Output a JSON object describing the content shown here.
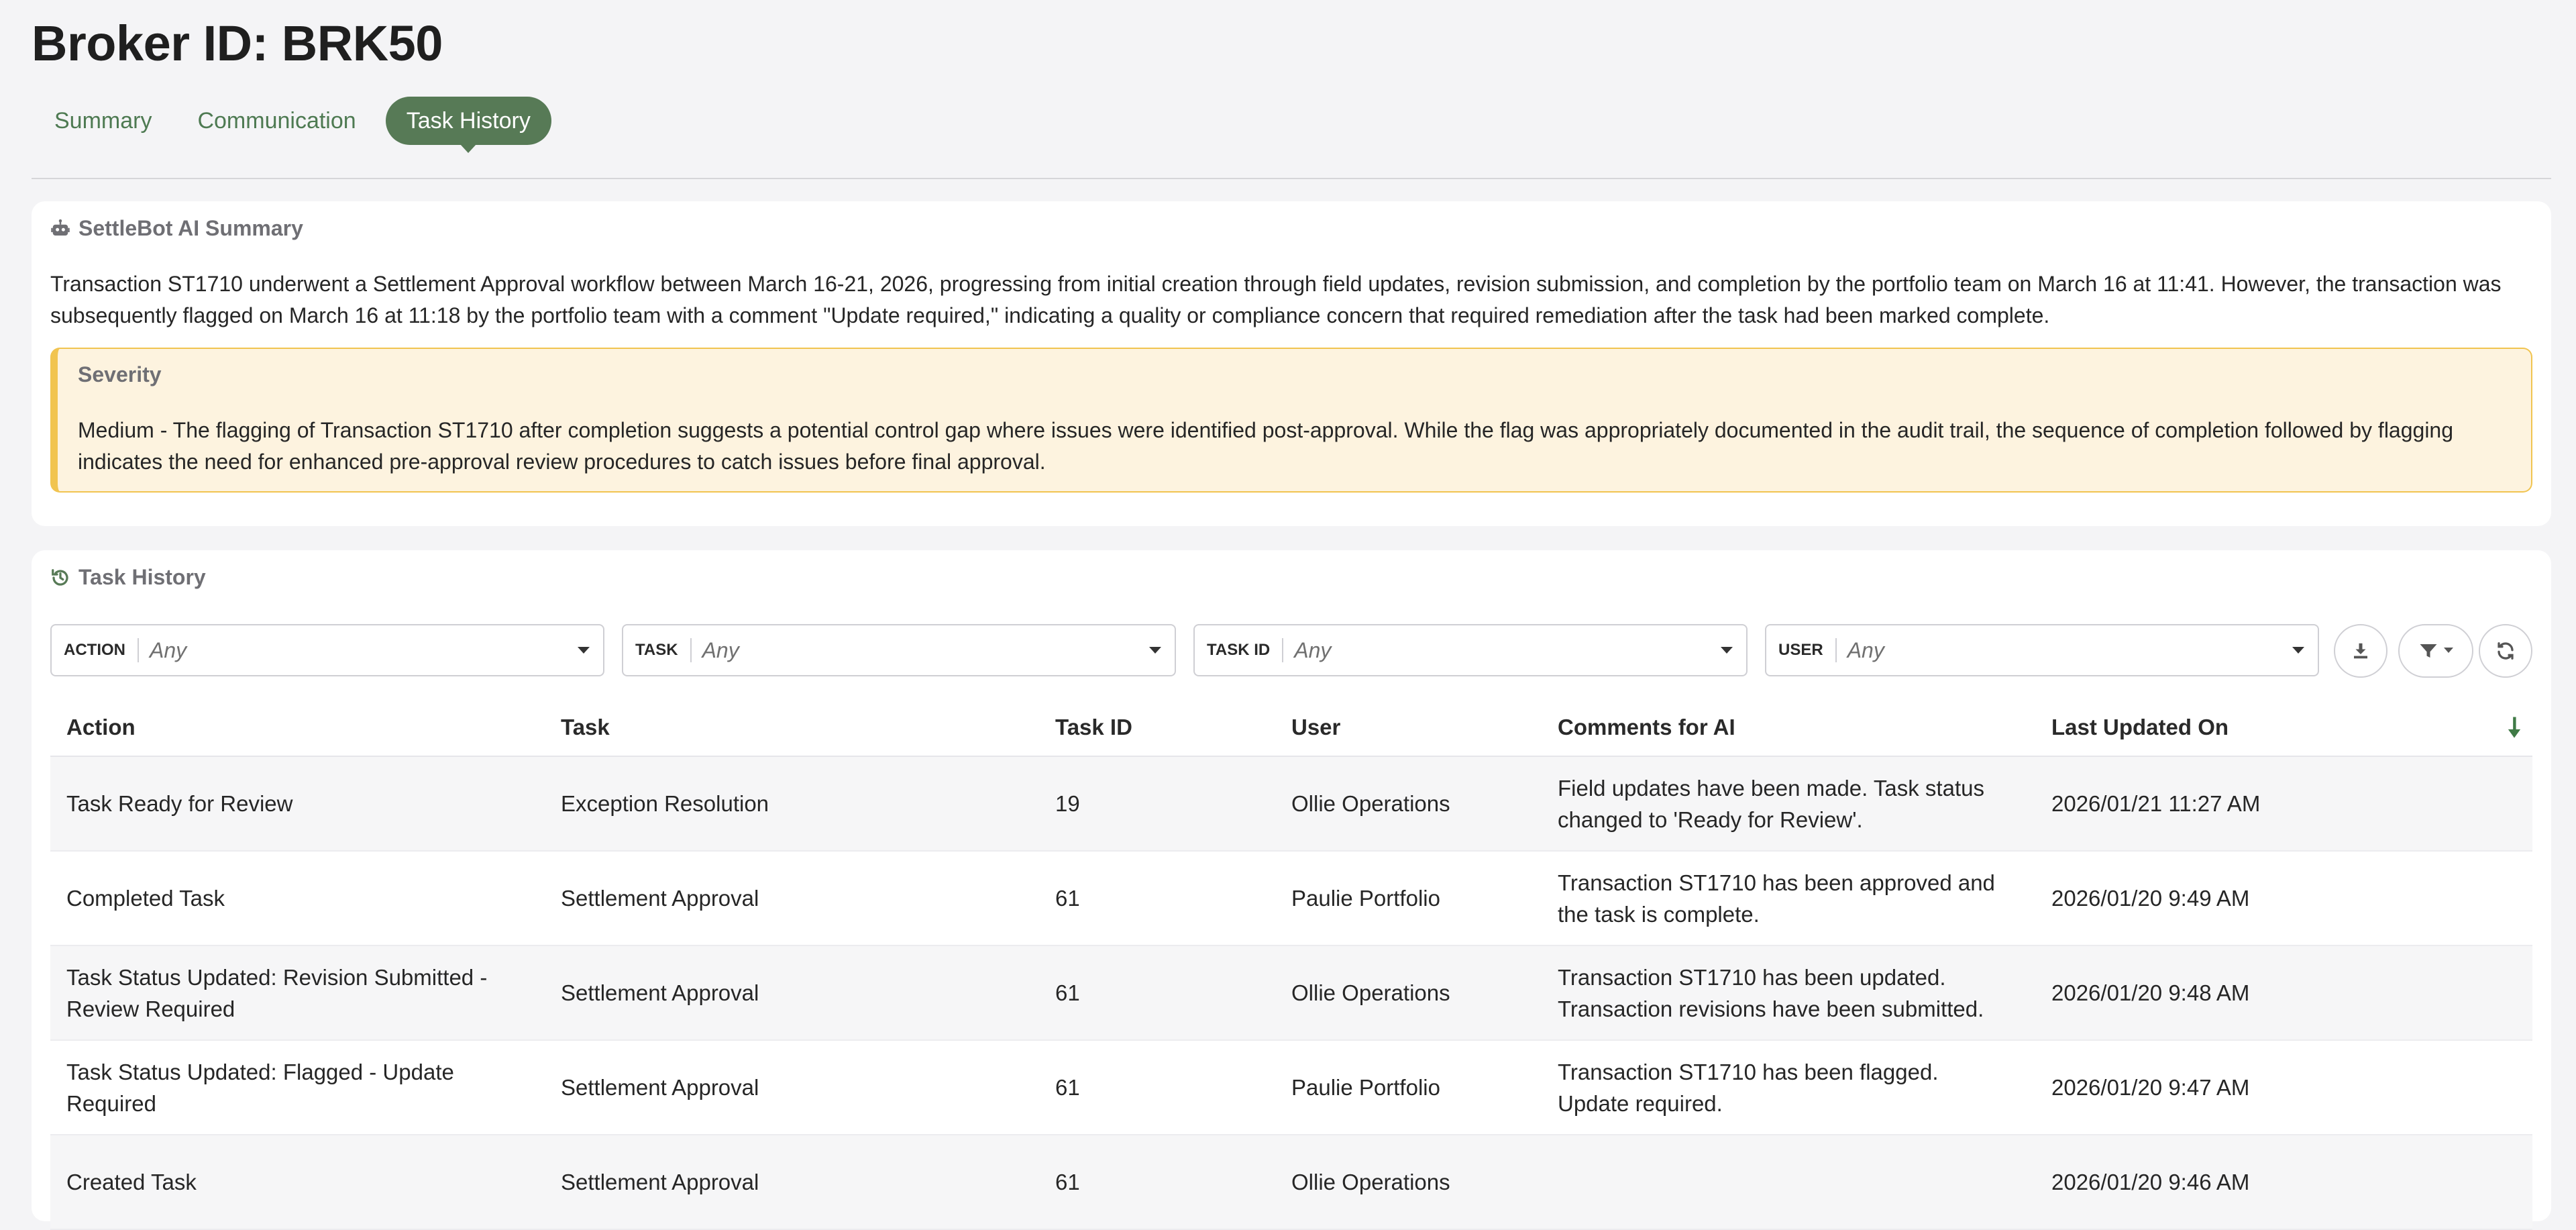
{
  "header": {
    "title": "Broker ID: BRK50",
    "tabs": [
      {
        "label": "Summary",
        "active": false
      },
      {
        "label": "Communication",
        "active": false
      },
      {
        "label": "Task History",
        "active": true
      }
    ]
  },
  "summary": {
    "title": "SettleBot AI Summary",
    "icon": "robot-icon",
    "text": "Transaction ST1710 underwent a Settlement Approval workflow between March 16-21, 2026, progressing from initial creation through field updates, revision submission, and completion by the portfolio team on March 16 at 11:41. However, the transaction was subsequently flagged on March 16 at 11:18 by the portfolio team with a comment \"Update required,\" indicating a quality or compliance concern that required remediation after the task had been marked complete.",
    "severity": {
      "label": "Severity",
      "text": "Medium - The flagging of Transaction ST1710 after completion suggests a potential control gap where issues were identified post-approval. While the flag was appropriately documented in the audit trail, the sequence of completion followed by flagging indicates the need for enhanced pre-approval review procedures to catch issues before final approval.",
      "accent_color": "#f1c450",
      "background_color": "#fdf3df"
    }
  },
  "task_history": {
    "title": "Task History",
    "icon": "history-icon",
    "filters": [
      {
        "label": "ACTION",
        "value": "Any"
      },
      {
        "label": "TASK",
        "value": "Any"
      },
      {
        "label": "TASK ID",
        "value": "Any"
      },
      {
        "label": "USER",
        "value": "Any"
      }
    ],
    "actions": [
      "download-icon",
      "filter-icon",
      "refresh-icon"
    ],
    "columns": [
      "Action",
      "Task",
      "Task ID",
      "User",
      "Comments for AI",
      "Last Updated On"
    ],
    "sort": {
      "column": "Last Updated On",
      "direction": "descending"
    },
    "rows": [
      {
        "action": "Task Ready for Review",
        "task": "Exception Resolution",
        "task_id": "19",
        "user": "Ollie Operations",
        "comments": "Field updates have been made. Task status changed to 'Ready for Review'.",
        "updated": "2026/01/21 11:27 AM"
      },
      {
        "action": "Completed Task",
        "task": "Settlement Approval",
        "task_id": "61",
        "user": "Paulie Portfolio",
        "comments": "Transaction ST1710 has been approved and the task is complete.",
        "updated": "2026/01/20 9:49 AM"
      },
      {
        "action": "Task Status Updated: Revision Submitted - Review Required",
        "task": "Settlement Approval",
        "task_id": "61",
        "user": "Ollie Operations",
        "comments": "Transaction ST1710 has been updated. Transaction revisions have been submitted.",
        "updated": "2026/01/20 9:48 AM"
      },
      {
        "action": "Task Status Updated: Flagged - Update Required",
        "task": "Settlement Approval",
        "task_id": "61",
        "user": "Paulie Portfolio",
        "comments": "Transaction ST1710 has been flagged. Update required.",
        "updated": "2026/01/20 9:47 AM"
      },
      {
        "action": "Created Task",
        "task": "Settlement Approval",
        "task_id": "61",
        "user": "Ollie Operations",
        "comments": "",
        "updated": "2026/01/20 9:46 AM"
      }
    ]
  },
  "colors": {
    "accent_green": "#577a56",
    "tab_text_green": "#4e7a52",
    "page_background": "#f4f4f6"
  }
}
